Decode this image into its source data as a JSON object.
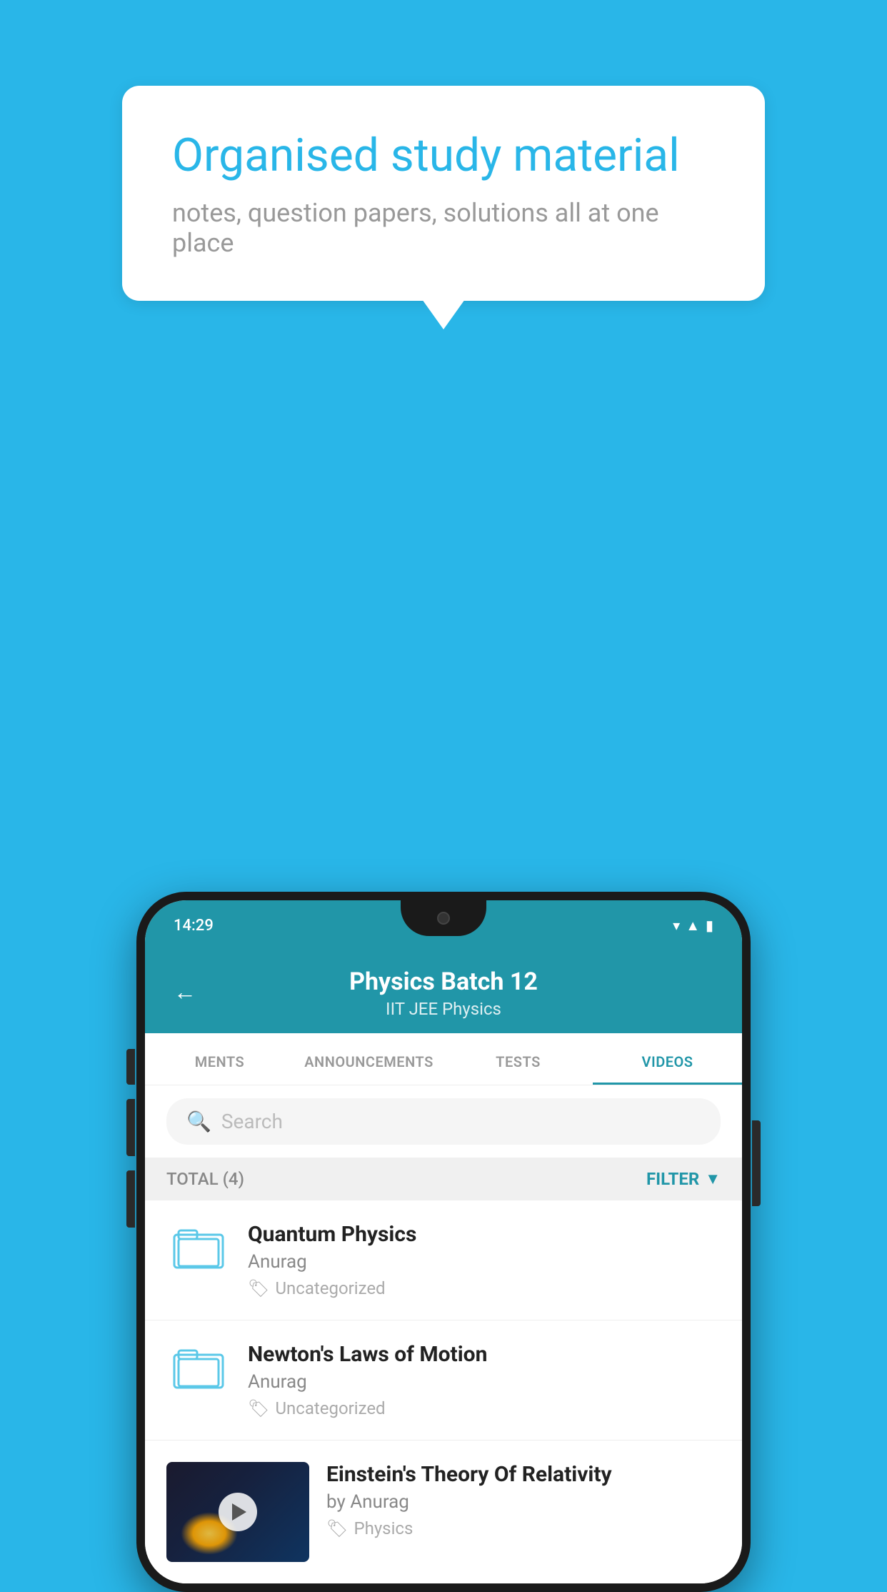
{
  "background_color": "#29b6e8",
  "bubble": {
    "title": "Organised study material",
    "subtitle": "notes, question papers, solutions all at one place"
  },
  "status_bar": {
    "time": "14:29",
    "wifi_icon": "▾",
    "signal_icon": "▲",
    "battery_icon": "▮"
  },
  "header": {
    "back_label": "←",
    "title": "Physics Batch 12",
    "subtitle": "IIT JEE    Physics"
  },
  "tabs": [
    {
      "label": "MENTS",
      "active": false
    },
    {
      "label": "ANNOUNCEMENTS",
      "active": false
    },
    {
      "label": "TESTS",
      "active": false
    },
    {
      "label": "VIDEOS",
      "active": true
    }
  ],
  "search": {
    "placeholder": "Search"
  },
  "filter_bar": {
    "total_label": "TOTAL (4)",
    "filter_label": "FILTER"
  },
  "video_items": [
    {
      "title": "Quantum Physics",
      "author": "Anurag",
      "tag": "Uncategorized",
      "has_thumbnail": false
    },
    {
      "title": "Newton's Laws of Motion",
      "author": "Anurag",
      "tag": "Uncategorized",
      "has_thumbnail": false
    },
    {
      "title": "Einstein's Theory Of Relativity",
      "author": "by Anurag",
      "tag": "Physics",
      "has_thumbnail": true
    }
  ],
  "accent_color": "#2196a8",
  "icons": {
    "back": "←",
    "search": "🔍",
    "filter": "▼",
    "tag": "🏷",
    "play": "▶"
  }
}
